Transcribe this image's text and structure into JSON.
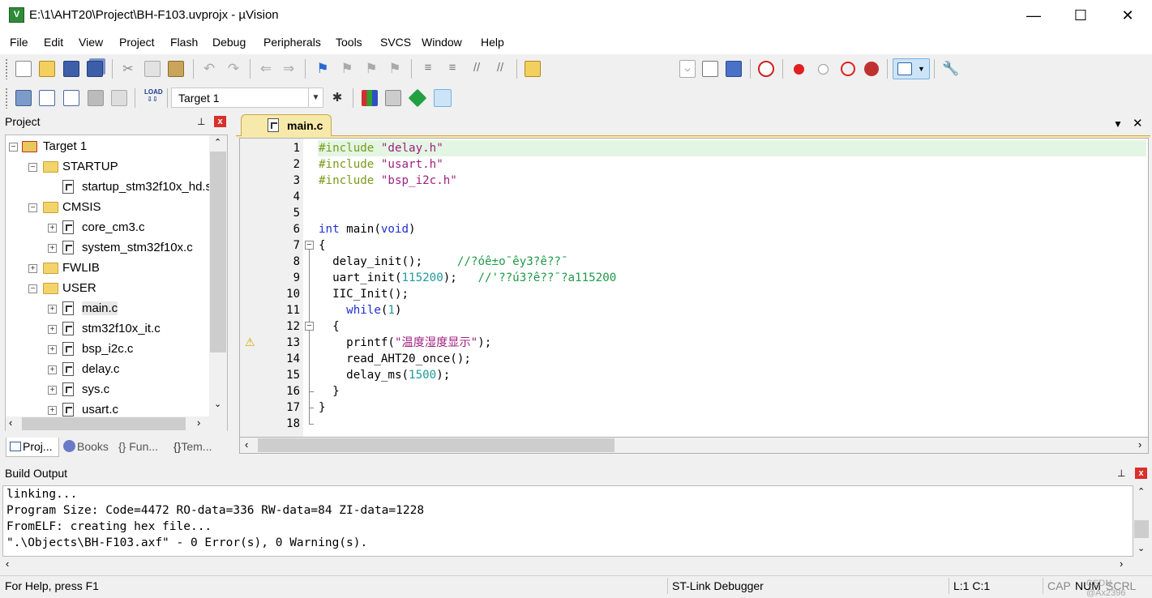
{
  "window": {
    "title": "E:\\1\\AHT20\\Project\\BH-F103.uvprojx - µVision",
    "app_icon": "uv-icon",
    "minimize": "—",
    "maximize": "☐",
    "close": "✕"
  },
  "menu": [
    "File",
    "Edit",
    "View",
    "Project",
    "Flash",
    "Debug",
    "Peripherals",
    "Tools",
    "SVCS",
    "Window",
    "Help"
  ],
  "toolbar2": {
    "target": "Target 1"
  },
  "project_panel": {
    "title": "Project",
    "pin": "📌",
    "close": "x",
    "tree": [
      {
        "label": "Target 1",
        "level": 0,
        "kind": "target",
        "expander": "−"
      },
      {
        "label": "STARTUP",
        "level": 1,
        "kind": "folder",
        "expander": "−"
      },
      {
        "label": "startup_stm32f10x_hd.s",
        "level": 2,
        "kind": "file",
        "expander": ""
      },
      {
        "label": "CMSIS",
        "level": 1,
        "kind": "folder",
        "expander": "−"
      },
      {
        "label": "core_cm3.c",
        "level": 2,
        "kind": "file",
        "expander": "+"
      },
      {
        "label": "system_stm32f10x.c",
        "level": 2,
        "kind": "file",
        "expander": "+"
      },
      {
        "label": "FWLIB",
        "level": 1,
        "kind": "folder",
        "expander": "+"
      },
      {
        "label": "USER",
        "level": 1,
        "kind": "folder",
        "expander": "−"
      },
      {
        "label": "main.c",
        "level": 2,
        "kind": "file",
        "expander": "+"
      },
      {
        "label": "stm32f10x_it.c",
        "level": 2,
        "kind": "file",
        "expander": "+"
      },
      {
        "label": "bsp_i2c.c",
        "level": 2,
        "kind": "file",
        "expander": "+"
      },
      {
        "label": "delay.c",
        "level": 2,
        "kind": "file",
        "expander": "+"
      },
      {
        "label": "sys.c",
        "level": 2,
        "kind": "file",
        "expander": "+"
      },
      {
        "label": "usart.c",
        "level": 2,
        "kind": "file",
        "expander": "+"
      }
    ],
    "tabs": [
      "Proj...",
      "Books",
      "{} Fun...",
      "Tem..."
    ]
  },
  "editor": {
    "tab_label": "main.c",
    "lines": [
      {
        "n": "1",
        "text": "#include \"delay.h\""
      },
      {
        "n": "2",
        "text": "#include \"usart.h\""
      },
      {
        "n": "3",
        "text": "#include \"bsp_i2c.h\""
      },
      {
        "n": "4",
        "text": ""
      },
      {
        "n": "5",
        "text": ""
      },
      {
        "n": "6",
        "text": "int main(void)"
      },
      {
        "n": "7",
        "text": "{"
      },
      {
        "n": "8",
        "text": "  delay_init();     //?óê±o¯êy3?ê??¯"
      },
      {
        "n": "9",
        "text": "  uart_init(115200);   //'??ú3?ê??¯?a115200"
      },
      {
        "n": "10",
        "text": "  IIC_Init();"
      },
      {
        "n": "11",
        "text": "    while(1)"
      },
      {
        "n": "12",
        "text": "  {"
      },
      {
        "n": "13",
        "text": "    printf(\"温度湿度显示\");"
      },
      {
        "n": "14",
        "text": "    read_AHT20_once();"
      },
      {
        "n": "15",
        "text": "    delay_ms(1500);"
      },
      {
        "n": "16",
        "text": "  }"
      },
      {
        "n": "17",
        "text": "}"
      },
      {
        "n": "18",
        "text": ""
      }
    ],
    "warning_line": "13"
  },
  "build_output": {
    "title": "Build Output",
    "lines": [
      "linking...",
      "Program Size: Code=4472 RO-data=336 RW-data=84 ZI-data=1228",
      "FromELF: creating hex file...",
      "\".\\Objects\\BH-F103.axf\" - 0 Error(s), 0 Warning(s)."
    ]
  },
  "status": {
    "help": "For Help, press F1",
    "debugger": "ST-Link Debugger",
    "position": "L:1 C:1",
    "cap": "CAP",
    "num": "NUM",
    "scrl": "SCRL",
    "watermark": "CSDN @Ax2396"
  },
  "colors": {
    "keyword": "#1f2fd0",
    "preprocessor": "#7a9a18",
    "string": "#a02080",
    "number": "#1f9a9a",
    "comment": "#1f9a4a",
    "current_line": "#e3f6e3",
    "tab_active": "#f7e9a9"
  }
}
